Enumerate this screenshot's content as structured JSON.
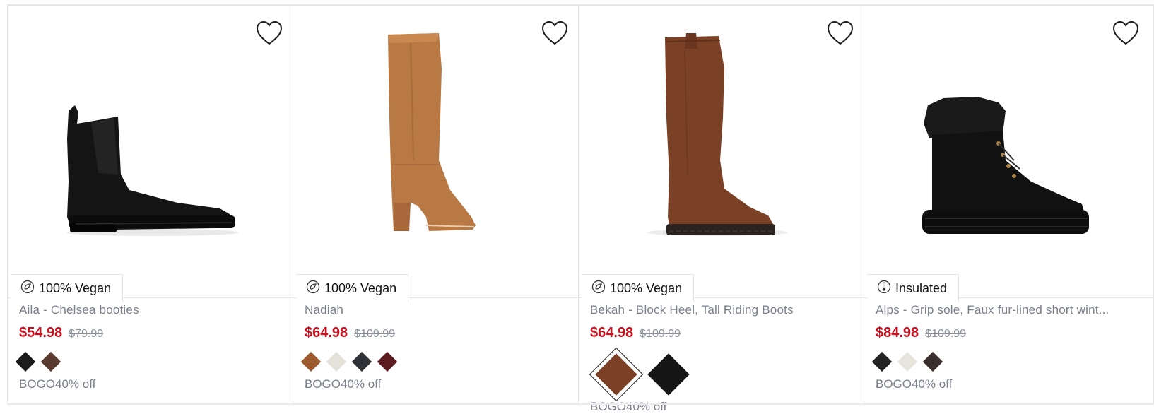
{
  "products": [
    {
      "badge": "100% Vegan",
      "badge_icon": "vegan-icon",
      "name": "Aila - Chelsea booties",
      "price": "$54.98",
      "original_price": "$79.99",
      "swatches": [
        "#1d1d1d",
        "#5a3a2e"
      ],
      "promo": "BOGO40% off"
    },
    {
      "badge": "100% Vegan",
      "badge_icon": "vegan-icon",
      "name": "Nadiah",
      "price": "$64.98",
      "original_price": "$109.99",
      "swatches": [
        "#9c5a2e",
        "#e4e1da",
        "#2f3338",
        "#5a1a1e"
      ],
      "promo": "BOGO40% off"
    },
    {
      "badge": "100% Vegan",
      "badge_icon": "vegan-icon",
      "name": "Bekah - Block Heel, Tall Riding Boots",
      "price": "$64.98",
      "original_price": "$109.99",
      "swatches": [
        "#7a4127",
        "#151515"
      ],
      "promo": "BOGO40% off"
    },
    {
      "badge": "Insulated",
      "badge_icon": "thermometer-icon",
      "name": "Alps - Grip sole, Faux fur-lined short wint...",
      "price": "$84.98",
      "original_price": "$109.99",
      "swatches": [
        "#222222",
        "#e6e4dc",
        "#3a2f2c"
      ],
      "promo": "BOGO40% off"
    }
  ],
  "icons": {
    "wishlist": "heart-outline-icon"
  }
}
